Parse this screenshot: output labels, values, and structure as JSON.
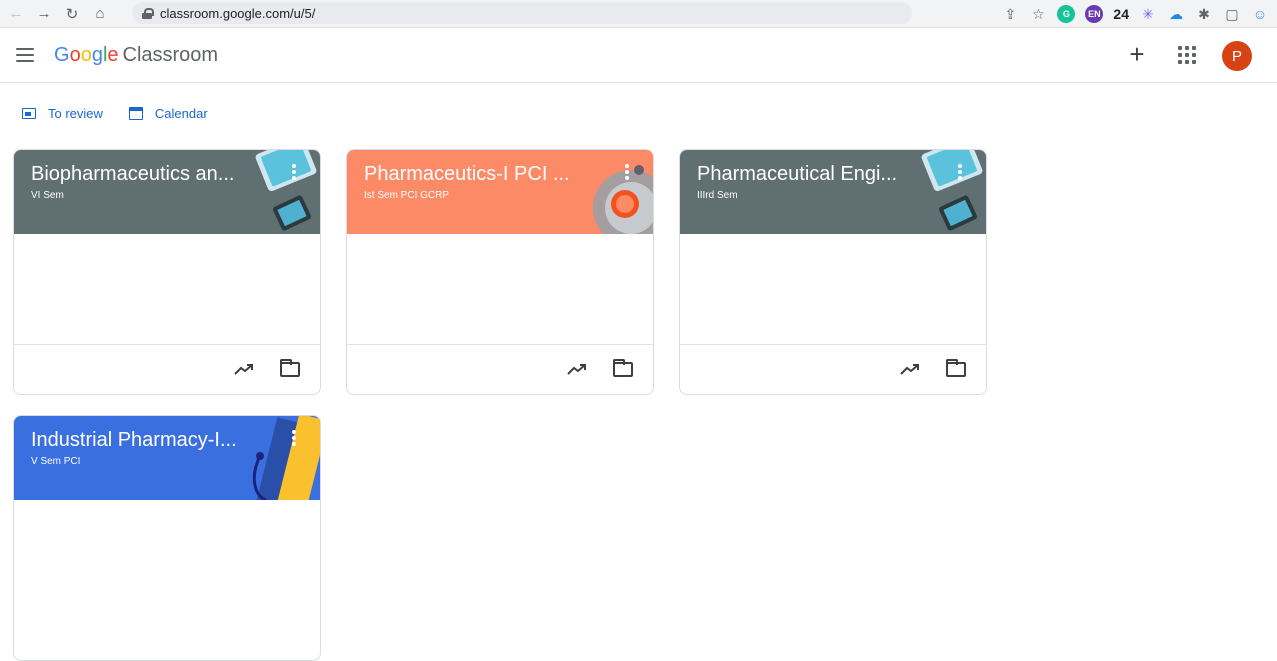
{
  "browser": {
    "url": "classroom.google.com/u/5/",
    "extension_count": "24",
    "extensions": [
      "share-icon",
      "star-icon",
      "grammarly-icon",
      "en-icon",
      "snowflake-icon",
      "cloud-icon",
      "puzzle-icon",
      "sidepanel-icon",
      "profile-icon"
    ]
  },
  "header": {
    "logo_letters": [
      "G",
      "o",
      "o",
      "g",
      "l",
      "e"
    ],
    "product": "Classroom",
    "avatar_letter": "P",
    "plus": "+"
  },
  "subnav": {
    "to_review": "To review",
    "calendar": "Calendar"
  },
  "classes": [
    {
      "title": "Biopharmaceutics an...",
      "section": "VI Sem",
      "color": "#5f6f72"
    },
    {
      "title": "Pharmaceutics-I PCI ...",
      "section": "Ist Sem PCI GCRP",
      "color": "#fc8a66"
    },
    {
      "title": "Pharmaceutical Engi...",
      "section": "IIIrd Sem",
      "color": "#5f6f72"
    },
    {
      "title": "Industrial Pharmacy-I...",
      "section": "V Sem PCI",
      "color": "#3a6fe0"
    }
  ]
}
